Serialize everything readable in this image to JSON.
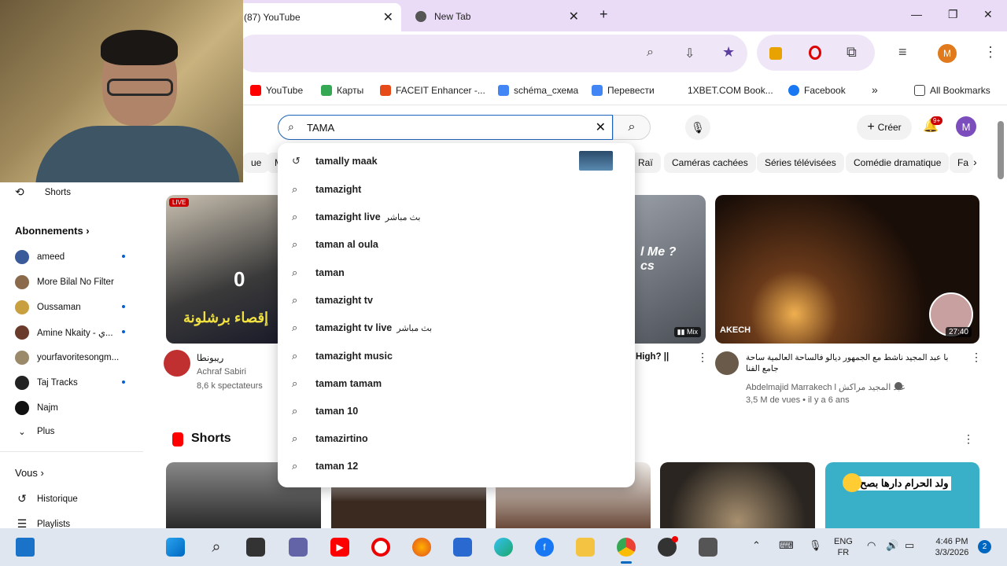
{
  "browser": {
    "tabs": [
      {
        "label": "(87) YouTube",
        "active": true
      },
      {
        "label": "New Tab",
        "active": false
      }
    ],
    "bookmarks": [
      "YouTube",
      "Карты",
      "FACEIT Enhancer -...",
      "schéma_схема",
      "Перевести",
      "1XBET.COM Book...",
      "Facebook",
      "All Bookmarks"
    ],
    "profile_letter": "M"
  },
  "youtube": {
    "search_value": "TAMA",
    "create_label": "Créer",
    "notif_badge": "9+",
    "avatar_letter": "M",
    "chips": [
      "ue",
      "M",
      "Raï",
      "Caméras cachées",
      "Séries télévisées",
      "Comédie dramatique",
      "Fa"
    ],
    "suggestions": [
      {
        "text": "tamally maak",
        "extra": "",
        "history": true
      },
      {
        "text": "tamazight",
        "extra": "",
        "history": false
      },
      {
        "text": "tamazight live",
        "extra": "بث مباشر",
        "history": false
      },
      {
        "text": "taman al oula",
        "extra": "",
        "history": false
      },
      {
        "text": "taman",
        "extra": "",
        "history": false
      },
      {
        "text": "tamazight tv",
        "extra": "",
        "history": false
      },
      {
        "text": "tamazight tv live",
        "extra": "بث مباشر",
        "history": false
      },
      {
        "text": "tamazight music",
        "extra": "",
        "history": false
      },
      {
        "text": "tamam tamam",
        "extra": "",
        "history": false
      },
      {
        "text": "taman 10",
        "extra": "",
        "history": false
      },
      {
        "text": "tamazirtino",
        "extra": "",
        "history": false
      },
      {
        "text": "taman 12",
        "extra": "",
        "history": false
      }
    ],
    "sidebar": {
      "shorts": "Shorts",
      "subs_header": "Abonnements",
      "subs": [
        "ameed",
        "More Bilal No Filter",
        "Oussaman",
        "Amine Nkaity - ي...",
        "yourfavoritesongm...",
        "Taj Tracks",
        "Najm"
      ],
      "more": "Plus",
      "you_header": "Vous",
      "history": "Historique",
      "playlists": "Playlists"
    },
    "videos": [
      {
        "live": "LIVE",
        "channel_title": "ريبونطا",
        "channel": "Achraf Sabiri",
        "meta": "8,6 k spectateurs",
        "thumb_text": "إقصاء برشلونة",
        "score": "0"
      },
      {
        "mix": "Mix",
        "title_fragment": "High? ||",
        "thumb_text": "l Me ? cs"
      },
      {
        "title": "با عبد المجيد ناشط مع الجمهور ديالو فالساحة العالمية ساحة جامع الفنا",
        "channel": "Abdelmajid Marrakech l عبد المجيد مراكش",
        "meta": "3,5 M de vues • il y a 6 ans",
        "duration": "27:40",
        "thumb_text": "AKECH"
      }
    ],
    "shorts_label": "Shorts",
    "short_overlay": "ولد الحرام دارها بصح"
  },
  "taskbar": {
    "lang1": "ENG",
    "lang2": "FR",
    "time": "4:46 PM",
    "date": "3/3/2026",
    "notif_count": "2"
  }
}
